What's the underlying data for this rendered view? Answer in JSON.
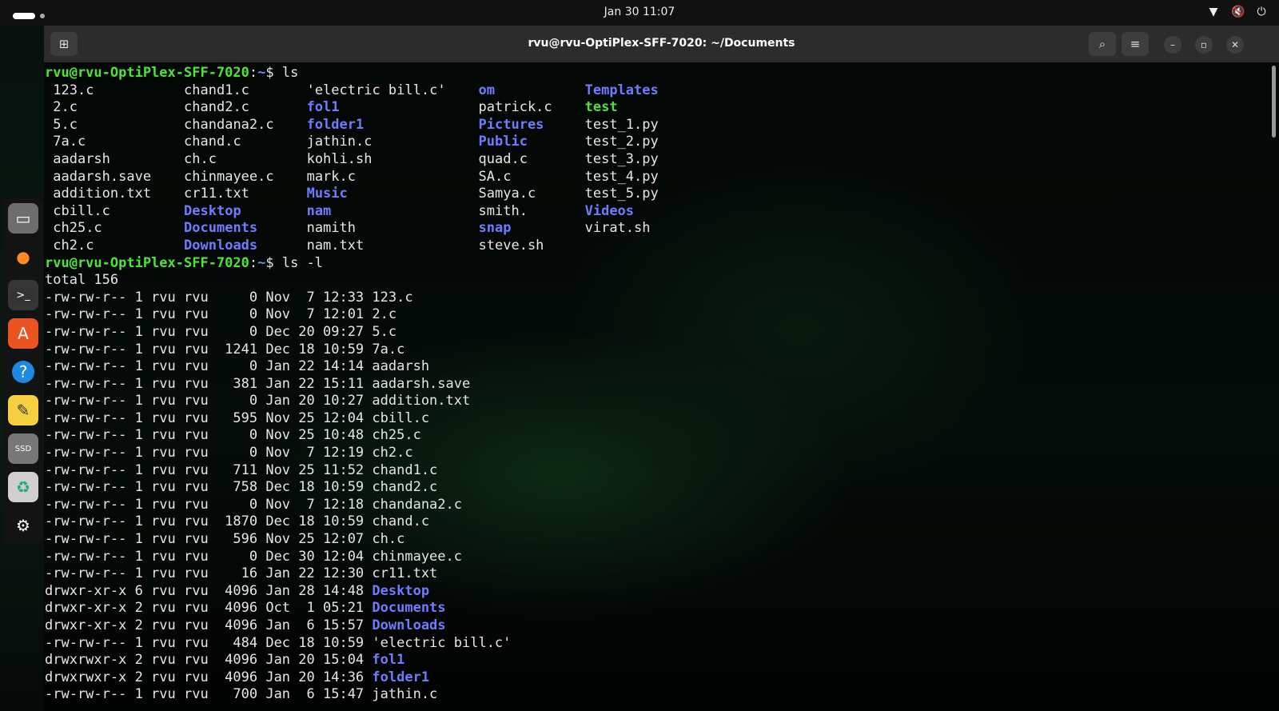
{
  "topbar": {
    "datetime": "Jan 30  11:07",
    "icons": [
      "wifi-icon",
      "volume-muted-icon",
      "power-icon"
    ]
  },
  "window": {
    "title": "rvu@rvu-OptiPlex-SFF-7020: ~/Documents"
  },
  "dock": [
    "files-icon",
    "firefox-icon",
    "terminal-icon",
    "app-center-icon",
    "help-icon",
    "text-editor-icon",
    "ssd-drive-icon",
    "trash-icon",
    "show-apps-icon"
  ],
  "colors": {
    "prompt_user": "#4fe33a",
    "prompt_path": "#6f8ee0",
    "directory": "#6f7cff",
    "executable": "#4fe33a"
  },
  "terminal": {
    "user_host": "rvu@rvu-OptiPlex-SFF-7020",
    "path": "~",
    "cmd1": "ls",
    "cmd2": "ls -l",
    "ls_rows": [
      [
        {
          "t": "123.c"
        },
        {
          "t": "chand1.c"
        },
        {
          "t": "'electric bill.c'"
        },
        {
          "t": "om",
          "c": "d"
        },
        {
          "t": "Templates",
          "c": "d"
        }
      ],
      [
        {
          "t": "2.c"
        },
        {
          "t": "chand2.c"
        },
        {
          "t": "fol1",
          "c": "d"
        },
        {
          "t": "patrick.c"
        },
        {
          "t": "test",
          "c": "g"
        }
      ],
      [
        {
          "t": "5.c"
        },
        {
          "t": "chandana2.c"
        },
        {
          "t": "folder1",
          "c": "d"
        },
        {
          "t": "Pictures",
          "c": "d"
        },
        {
          "t": "test_1.py"
        }
      ],
      [
        {
          "t": "7a.c"
        },
        {
          "t": "chand.c"
        },
        {
          "t": "jathin.c"
        },
        {
          "t": "Public",
          "c": "d"
        },
        {
          "t": "test_2.py"
        }
      ],
      [
        {
          "t": "aadarsh"
        },
        {
          "t": "ch.c"
        },
        {
          "t": "kohli.sh"
        },
        {
          "t": "quad.c"
        },
        {
          "t": "test_3.py"
        }
      ],
      [
        {
          "t": "aadarsh.save"
        },
        {
          "t": "chinmayee.c"
        },
        {
          "t": "mark.c"
        },
        {
          "t": "SA.c"
        },
        {
          "t": "test_4.py"
        }
      ],
      [
        {
          "t": "addition.txt"
        },
        {
          "t": "cr11.txt"
        },
        {
          "t": "Music",
          "c": "d"
        },
        {
          "t": "Samya.c"
        },
        {
          "t": "test_5.py"
        }
      ],
      [
        {
          "t": "cbill.c"
        },
        {
          "t": "Desktop",
          "c": "d"
        },
        {
          "t": "nam",
          "c": "d"
        },
        {
          "t": "smith."
        },
        {
          "t": "Videos",
          "c": "d"
        }
      ],
      [
        {
          "t": "ch25.c"
        },
        {
          "t": "Documents",
          "c": "d"
        },
        {
          "t": "namith"
        },
        {
          "t": "snap",
          "c": "d"
        },
        {
          "t": "virat.sh"
        }
      ],
      [
        {
          "t": "ch2.c"
        },
        {
          "t": "Downloads",
          "c": "d"
        },
        {
          "t": "nam.txt"
        },
        {
          "t": "steve.sh"
        },
        {
          "t": ""
        }
      ]
    ],
    "total": "total 156",
    "long_rows": [
      {
        "perm": "-rw-rw-r--",
        "links": "1",
        "owner": "rvu",
        "group": "rvu",
        "size": "0",
        "date": "Nov  7 12:33",
        "name": "123.c"
      },
      {
        "perm": "-rw-rw-r--",
        "links": "1",
        "owner": "rvu",
        "group": "rvu",
        "size": "0",
        "date": "Nov  7 12:01",
        "name": "2.c"
      },
      {
        "perm": "-rw-rw-r--",
        "links": "1",
        "owner": "rvu",
        "group": "rvu",
        "size": "0",
        "date": "Dec 20 09:27",
        "name": "5.c"
      },
      {
        "perm": "-rw-rw-r--",
        "links": "1",
        "owner": "rvu",
        "group": "rvu",
        "size": "1241",
        "date": "Dec 18 10:59",
        "name": "7a.c"
      },
      {
        "perm": "-rw-rw-r--",
        "links": "1",
        "owner": "rvu",
        "group": "rvu",
        "size": "0",
        "date": "Jan 22 14:14",
        "name": "aadarsh"
      },
      {
        "perm": "-rw-rw-r--",
        "links": "1",
        "owner": "rvu",
        "group": "rvu",
        "size": "381",
        "date": "Jan 22 15:11",
        "name": "aadarsh.save"
      },
      {
        "perm": "-rw-rw-r--",
        "links": "1",
        "owner": "rvu",
        "group": "rvu",
        "size": "0",
        "date": "Jan 20 10:27",
        "name": "addition.txt"
      },
      {
        "perm": "-rw-rw-r--",
        "links": "1",
        "owner": "rvu",
        "group": "rvu",
        "size": "595",
        "date": "Nov 25 12:04",
        "name": "cbill.c"
      },
      {
        "perm": "-rw-rw-r--",
        "links": "1",
        "owner": "rvu",
        "group": "rvu",
        "size": "0",
        "date": "Nov 25 10:48",
        "name": "ch25.c"
      },
      {
        "perm": "-rw-rw-r--",
        "links": "1",
        "owner": "rvu",
        "group": "rvu",
        "size": "0",
        "date": "Nov  7 12:19",
        "name": "ch2.c"
      },
      {
        "perm": "-rw-rw-r--",
        "links": "1",
        "owner": "rvu",
        "group": "rvu",
        "size": "711",
        "date": "Nov 25 11:52",
        "name": "chand1.c"
      },
      {
        "perm": "-rw-rw-r--",
        "links": "1",
        "owner": "rvu",
        "group": "rvu",
        "size": "758",
        "date": "Dec 18 10:59",
        "name": "chand2.c"
      },
      {
        "perm": "-rw-rw-r--",
        "links": "1",
        "owner": "rvu",
        "group": "rvu",
        "size": "0",
        "date": "Nov  7 12:18",
        "name": "chandana2.c"
      },
      {
        "perm": "-rw-rw-r--",
        "links": "1",
        "owner": "rvu",
        "group": "rvu",
        "size": "1870",
        "date": "Dec 18 10:59",
        "name": "chand.c"
      },
      {
        "perm": "-rw-rw-r--",
        "links": "1",
        "owner": "rvu",
        "group": "rvu",
        "size": "596",
        "date": "Nov 25 12:07",
        "name": "ch.c"
      },
      {
        "perm": "-rw-rw-r--",
        "links": "1",
        "owner": "rvu",
        "group": "rvu",
        "size": "0",
        "date": "Dec 30 12:04",
        "name": "chinmayee.c"
      },
      {
        "perm": "-rw-rw-r--",
        "links": "1",
        "owner": "rvu",
        "group": "rvu",
        "size": "16",
        "date": "Jan 22 12:30",
        "name": "cr11.txt"
      },
      {
        "perm": "drwxr-xr-x",
        "links": "6",
        "owner": "rvu",
        "group": "rvu",
        "size": "4096",
        "date": "Jan 28 14:48",
        "name": "Desktop",
        "c": "d"
      },
      {
        "perm": "drwxr-xr-x",
        "links": "2",
        "owner": "rvu",
        "group": "rvu",
        "size": "4096",
        "date": "Oct  1 05:21",
        "name": "Documents",
        "c": "d"
      },
      {
        "perm": "drwxr-xr-x",
        "links": "2",
        "owner": "rvu",
        "group": "rvu",
        "size": "4096",
        "date": "Jan  6 15:57",
        "name": "Downloads",
        "c": "d"
      },
      {
        "perm": "-rw-rw-r--",
        "links": "1",
        "owner": "rvu",
        "group": "rvu",
        "size": "484",
        "date": "Dec 18 10:59",
        "name": "'electric bill.c'"
      },
      {
        "perm": "drwxrwxr-x",
        "links": "2",
        "owner": "rvu",
        "group": "rvu",
        "size": "4096",
        "date": "Jan 20 15:04",
        "name": "fol1",
        "c": "d"
      },
      {
        "perm": "drwxrwxr-x",
        "links": "2",
        "owner": "rvu",
        "group": "rvu",
        "size": "4096",
        "date": "Jan 20 14:36",
        "name": "folder1",
        "c": "d"
      },
      {
        "perm": "-rw-rw-r--",
        "links": "1",
        "owner": "rvu",
        "group": "rvu",
        "size": "700",
        "date": "Jan  6 15:47",
        "name": "jathin.c"
      }
    ]
  }
}
